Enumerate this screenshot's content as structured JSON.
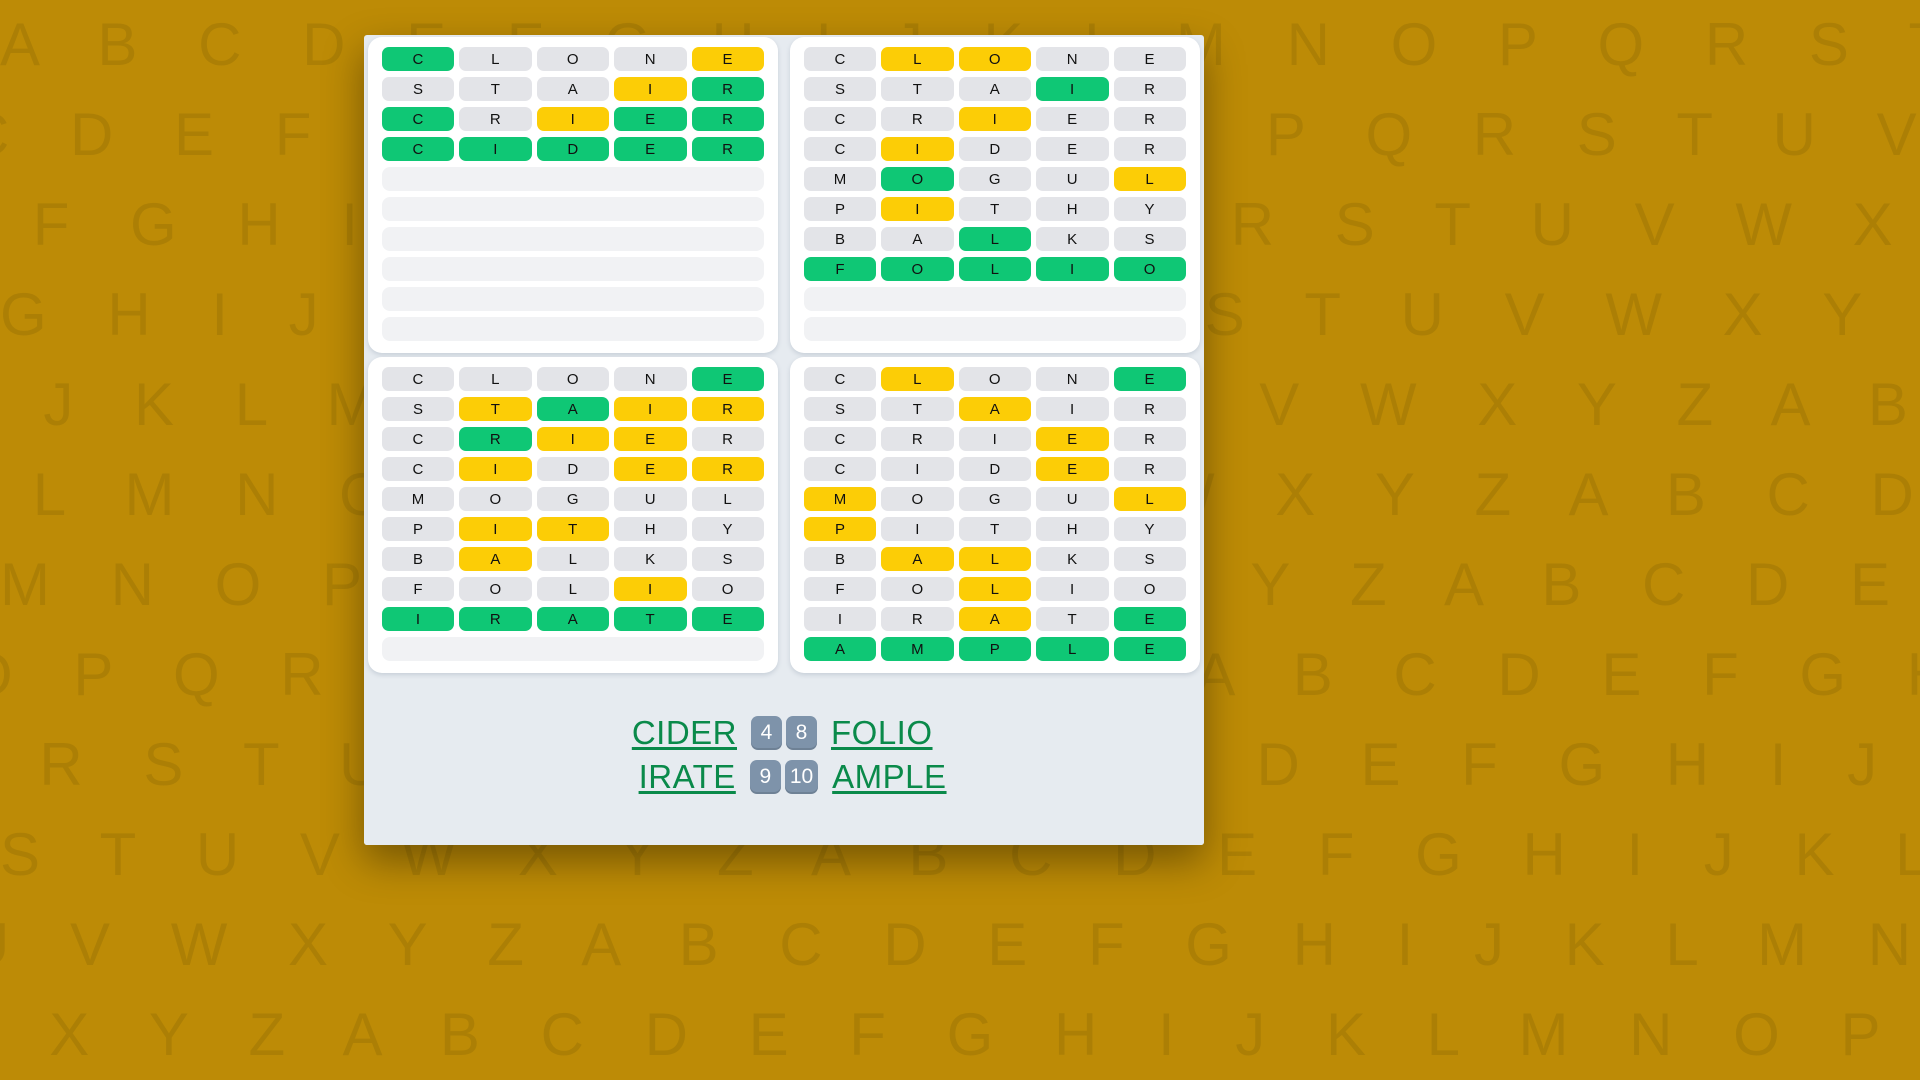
{
  "theme": {
    "background": "#bd8b06",
    "card_background": "#e6ebf0",
    "panel_background": "#ffffff",
    "tile_absent": "#e3e4e8",
    "tile_present": "#fccd06",
    "tile_correct": "#0fc775",
    "tile_empty": "#f1f2f4",
    "word_link_color": "#0a8a4a",
    "badge_color": "#7e93aa"
  },
  "wallpaper": {
    "letters": "A B C D E F G H I J K L M N O P Q R S T U V W X Y Z",
    "rows": 12
  },
  "boards": [
    {
      "name": "board-top-left",
      "solved_on_guess": 4,
      "rows": [
        {
          "letters": [
            "C",
            "L",
            "O",
            "N",
            "E"
          ],
          "states": [
            "c",
            "g",
            "g",
            "g",
            "y"
          ]
        },
        {
          "letters": [
            "S",
            "T",
            "A",
            "I",
            "R"
          ],
          "states": [
            "g",
            "g",
            "g",
            "y",
            "c"
          ]
        },
        {
          "letters": [
            "C",
            "R",
            "I",
            "E",
            "R"
          ],
          "states": [
            "c",
            "g",
            "y",
            "c",
            "c"
          ]
        },
        {
          "letters": [
            "C",
            "I",
            "D",
            "E",
            "R"
          ],
          "states": [
            "c",
            "c",
            "c",
            "c",
            "c"
          ]
        },
        {
          "letters": [
            "",
            "",
            "",
            "",
            ""
          ],
          "states": [
            "e",
            "e",
            "e",
            "e",
            "e"
          ]
        },
        {
          "letters": [
            "",
            "",
            "",
            "",
            ""
          ],
          "states": [
            "e",
            "e",
            "e",
            "e",
            "e"
          ]
        },
        {
          "letters": [
            "",
            "",
            "",
            "",
            ""
          ],
          "states": [
            "e",
            "e",
            "e",
            "e",
            "e"
          ]
        },
        {
          "letters": [
            "",
            "",
            "",
            "",
            ""
          ],
          "states": [
            "e",
            "e",
            "e",
            "e",
            "e"
          ]
        },
        {
          "letters": [
            "",
            "",
            "",
            "",
            ""
          ],
          "states": [
            "e",
            "e",
            "e",
            "e",
            "e"
          ]
        },
        {
          "letters": [
            "",
            "",
            "",
            "",
            ""
          ],
          "states": [
            "e",
            "e",
            "e",
            "e",
            "e"
          ]
        }
      ]
    },
    {
      "name": "board-top-right",
      "solved_on_guess": 8,
      "rows": [
        {
          "letters": [
            "C",
            "L",
            "O",
            "N",
            "E"
          ],
          "states": [
            "g",
            "y",
            "y",
            "g",
            "g"
          ]
        },
        {
          "letters": [
            "S",
            "T",
            "A",
            "I",
            "R"
          ],
          "states": [
            "g",
            "g",
            "g",
            "c",
            "g"
          ]
        },
        {
          "letters": [
            "C",
            "R",
            "I",
            "E",
            "R"
          ],
          "states": [
            "g",
            "g",
            "y",
            "g",
            "g"
          ]
        },
        {
          "letters": [
            "C",
            "I",
            "D",
            "E",
            "R"
          ],
          "states": [
            "g",
            "y",
            "g",
            "g",
            "g"
          ]
        },
        {
          "letters": [
            "M",
            "O",
            "G",
            "U",
            "L"
          ],
          "states": [
            "g",
            "c",
            "g",
            "g",
            "y"
          ]
        },
        {
          "letters": [
            "P",
            "I",
            "T",
            "H",
            "Y"
          ],
          "states": [
            "g",
            "y",
            "g",
            "g",
            "g"
          ]
        },
        {
          "letters": [
            "B",
            "A",
            "L",
            "K",
            "S"
          ],
          "states": [
            "g",
            "g",
            "c",
            "g",
            "g"
          ]
        },
        {
          "letters": [
            "F",
            "O",
            "L",
            "I",
            "O"
          ],
          "states": [
            "c",
            "c",
            "c",
            "c",
            "c"
          ]
        },
        {
          "letters": [
            "",
            "",
            "",
            "",
            ""
          ],
          "states": [
            "e",
            "e",
            "e",
            "e",
            "e"
          ]
        },
        {
          "letters": [
            "",
            "",
            "",
            "",
            ""
          ],
          "states": [
            "e",
            "e",
            "e",
            "e",
            "e"
          ]
        }
      ]
    },
    {
      "name": "board-bottom-left",
      "solved_on_guess": 9,
      "rows": [
        {
          "letters": [
            "C",
            "L",
            "O",
            "N",
            "E"
          ],
          "states": [
            "g",
            "g",
            "g",
            "g",
            "c"
          ]
        },
        {
          "letters": [
            "S",
            "T",
            "A",
            "I",
            "R"
          ],
          "states": [
            "g",
            "y",
            "c",
            "y",
            "y"
          ]
        },
        {
          "letters": [
            "C",
            "R",
            "I",
            "E",
            "R"
          ],
          "states": [
            "g",
            "c",
            "y",
            "y",
            "g"
          ]
        },
        {
          "letters": [
            "C",
            "I",
            "D",
            "E",
            "R"
          ],
          "states": [
            "g",
            "y",
            "g",
            "y",
            "y"
          ]
        },
        {
          "letters": [
            "M",
            "O",
            "G",
            "U",
            "L"
          ],
          "states": [
            "g",
            "g",
            "g",
            "g",
            "g"
          ]
        },
        {
          "letters": [
            "P",
            "I",
            "T",
            "H",
            "Y"
          ],
          "states": [
            "g",
            "y",
            "y",
            "g",
            "g"
          ]
        },
        {
          "letters": [
            "B",
            "A",
            "L",
            "K",
            "S"
          ],
          "states": [
            "g",
            "y",
            "g",
            "g",
            "g"
          ]
        },
        {
          "letters": [
            "F",
            "O",
            "L",
            "I",
            "O"
          ],
          "states": [
            "g",
            "g",
            "g",
            "y",
            "g"
          ]
        },
        {
          "letters": [
            "I",
            "R",
            "A",
            "T",
            "E"
          ],
          "states": [
            "c",
            "c",
            "c",
            "c",
            "c"
          ]
        },
        {
          "letters": [
            "",
            "",
            "",
            "",
            ""
          ],
          "states": [
            "e",
            "e",
            "e",
            "e",
            "e"
          ]
        }
      ]
    },
    {
      "name": "board-bottom-right",
      "solved_on_guess": 10,
      "rows": [
        {
          "letters": [
            "C",
            "L",
            "O",
            "N",
            "E"
          ],
          "states": [
            "g",
            "y",
            "g",
            "g",
            "c"
          ]
        },
        {
          "letters": [
            "S",
            "T",
            "A",
            "I",
            "R"
          ],
          "states": [
            "g",
            "g",
            "y",
            "g",
            "g"
          ]
        },
        {
          "letters": [
            "C",
            "R",
            "I",
            "E",
            "R"
          ],
          "states": [
            "g",
            "g",
            "g",
            "y",
            "g"
          ]
        },
        {
          "letters": [
            "C",
            "I",
            "D",
            "E",
            "R"
          ],
          "states": [
            "g",
            "g",
            "g",
            "y",
            "g"
          ]
        },
        {
          "letters": [
            "M",
            "O",
            "G",
            "U",
            "L"
          ],
          "states": [
            "y",
            "g",
            "g",
            "g",
            "y"
          ]
        },
        {
          "letters": [
            "P",
            "I",
            "T",
            "H",
            "Y"
          ],
          "states": [
            "y",
            "g",
            "g",
            "g",
            "g"
          ]
        },
        {
          "letters": [
            "B",
            "A",
            "L",
            "K",
            "S"
          ],
          "states": [
            "g",
            "y",
            "y",
            "g",
            "g"
          ]
        },
        {
          "letters": [
            "F",
            "O",
            "L",
            "I",
            "O"
          ],
          "states": [
            "g",
            "g",
            "y",
            "g",
            "g"
          ]
        },
        {
          "letters": [
            "I",
            "R",
            "A",
            "T",
            "E"
          ],
          "states": [
            "g",
            "g",
            "y",
            "g",
            "c"
          ]
        },
        {
          "letters": [
            "A",
            "M",
            "P",
            "L",
            "E"
          ],
          "states": [
            "c",
            "c",
            "c",
            "c",
            "c"
          ]
        }
      ]
    }
  ],
  "footer": {
    "lines": [
      {
        "left_word": "CIDER",
        "left_badge": "4",
        "right_badge": "8",
        "right_word": "FOLIO"
      },
      {
        "left_word": "IRATE",
        "left_badge": "9",
        "right_badge": "10",
        "right_word": "AMPLE"
      }
    ]
  }
}
